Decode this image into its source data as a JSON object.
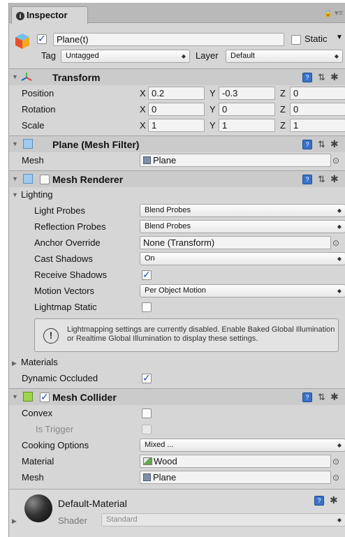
{
  "tab": {
    "label": "Inspector",
    "lock": "🔒",
    "menu": "▾≡"
  },
  "gameobject": {
    "name": "Plane(t)",
    "static_label": "Static",
    "tag_label": "Tag",
    "tag_value": "Untagged",
    "layer_label": "Layer",
    "layer_value": "Default"
  },
  "transform": {
    "title": "Transform",
    "position_label": "Position",
    "position": {
      "x": "0.2",
      "y": "-0.3",
      "z": "0"
    },
    "rotation_label": "Rotation",
    "rotation": {
      "x": "0",
      "y": "0",
      "z": "0"
    },
    "scale_label": "Scale",
    "scale": {
      "x": "1",
      "y": "1",
      "z": "1"
    },
    "axis_x": "X",
    "axis_y": "Y",
    "axis_z": "Z"
  },
  "mesh_filter": {
    "title": "Plane (Mesh Filter)",
    "mesh_label": "Mesh",
    "mesh_value": "Plane"
  },
  "mesh_renderer": {
    "title": "Mesh Renderer",
    "lighting_label": "Lighting",
    "light_probes_label": "Light Probes",
    "light_probes_value": "Blend Probes",
    "reflection_probes_label": "Reflection Probes",
    "reflection_probes_value": "Blend Probes",
    "anchor_override_label": "Anchor Override",
    "anchor_override_value": "None (Transform)",
    "cast_shadows_label": "Cast Shadows",
    "cast_shadows_value": "On",
    "receive_shadows_label": "Receive Shadows",
    "motion_vectors_label": "Motion Vectors",
    "motion_vectors_value": "Per Object Motion",
    "lightmap_static_label": "Lightmap Static",
    "info_text": "Lightmapping settings are currently disabled. Enable Baked Global Illumination or Realtime Global Illumination to display these settings.",
    "materials_label": "Materials",
    "dynamic_occluded_label": "Dynamic Occluded"
  },
  "mesh_collider": {
    "title": "Mesh Collider",
    "convex_label": "Convex",
    "is_trigger_label": "Is Trigger",
    "cooking_options_label": "Cooking Options",
    "cooking_options_value": "Mixed ...",
    "material_label": "Material",
    "material_value": "Wood",
    "mesh_label": "Mesh",
    "mesh_value": "Plane"
  },
  "material": {
    "name": "Default-Material",
    "shader_label": "Shader",
    "shader_value": "Standard"
  },
  "colors": {
    "panel": "#d6d6d6",
    "header": "#cbcbcb",
    "accent": "#3a72c8",
    "checkmark": "#1f4fb5"
  },
  "icons": [
    "info-icon",
    "lock-icon",
    "cube-icon",
    "transform-axes-icon",
    "mesh-filter-icon",
    "mesh-renderer-icon",
    "mesh-collider-icon",
    "help-book-icon",
    "preset-icon",
    "gear-icon",
    "object-picker-icon",
    "warning-icon",
    "material-sphere-icon"
  ]
}
